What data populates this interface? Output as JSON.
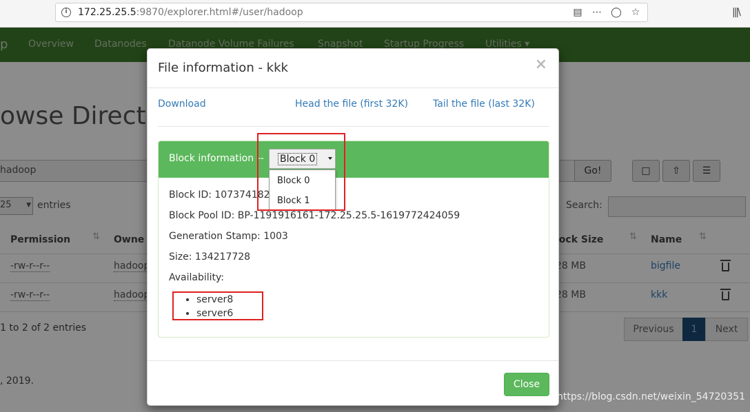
{
  "browser": {
    "url_host": "172.25.25.5",
    "url_rest": ":9870/explorer.html#/user/hadoop"
  },
  "navbar": {
    "brand": "p",
    "items": [
      "Overview",
      "Datanodes",
      "Datanode Volume Failures",
      "Snapshot",
      "Startup Progress",
      "Utilities ▾"
    ]
  },
  "background": {
    "title": "owse Directo",
    "path_value": "hadoop",
    "go_label": "Go!",
    "page_size": "25",
    "entries_label": "entries",
    "search_label": "Search:",
    "columns": [
      "Permission",
      "Owne",
      "lock Size",
      "Name"
    ],
    "rows": [
      {
        "permission": "-rw-r--r--",
        "owner": "hadoop",
        "size": "28 MB",
        "name": "bigfile"
      },
      {
        "permission": "-rw-r--r--",
        "owner": "hadoop",
        "size": "28 MB",
        "name": "kkk"
      }
    ],
    "showing": "1 to 2 of 2 entries",
    "pager": {
      "previous": "Previous",
      "current": "1",
      "next": "Next"
    },
    "footer": ", 2019."
  },
  "modal": {
    "title": "File information - kkk",
    "close_x": "×",
    "download": "Download",
    "head": "Head the file (first 32K)",
    "tail": "Tail the file (last 32K)",
    "block_info_label": "Block information --",
    "selected_block": "Block 0",
    "block_options": [
      "Block 0",
      "Block 1"
    ],
    "block_id": "Block ID: 107374182",
    "block_pool_id": "Block Pool ID: BP-1191916161-172.25.25.5-1619772424059",
    "generation_stamp": "Generation Stamp: 1003",
    "size": "Size: 134217728",
    "availability_label": "Availability:",
    "servers": [
      "server8",
      "server6"
    ],
    "close_button": "Close"
  },
  "watermark": "https://blog.csdn.net/weixin_54720351",
  "colors": {
    "navbar": "#3f7a2a",
    "panel_header": "#5cb85c",
    "link": "#337ab7",
    "annotation": "#e02020"
  }
}
